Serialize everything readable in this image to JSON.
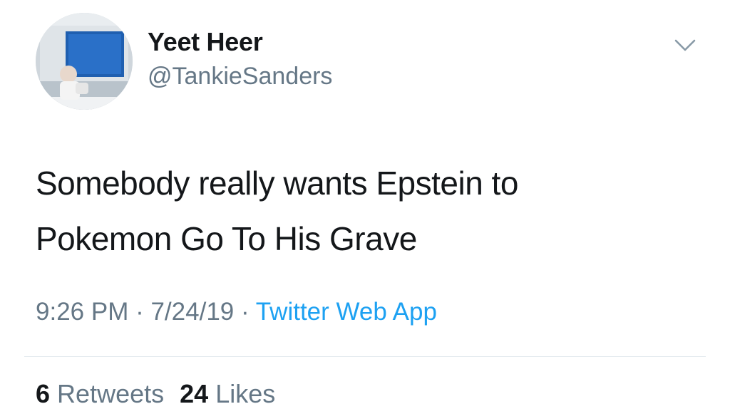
{
  "author": {
    "display_name": "Yeet Heer",
    "handle": "@TankieSanders",
    "avatar_icon": "profile-photo-avatar"
  },
  "menu": {
    "icon": "chevron-down-icon"
  },
  "tweet": {
    "lines": [
      "Somebody really wants Epstein to",
      "Pokemon Go To His Grave"
    ]
  },
  "meta": {
    "time": "9:26 PM",
    "separator": " · ",
    "date": "7/24/19",
    "source": "Twitter Web App"
  },
  "stats": {
    "retweets_count": "6",
    "retweets_label": "Retweets",
    "likes_count": "24",
    "likes_label": "Likes"
  },
  "colors": {
    "link": "#1da1f2",
    "secondary_text": "#657786",
    "primary_text": "#14171a",
    "divider": "#e1e8ed"
  }
}
